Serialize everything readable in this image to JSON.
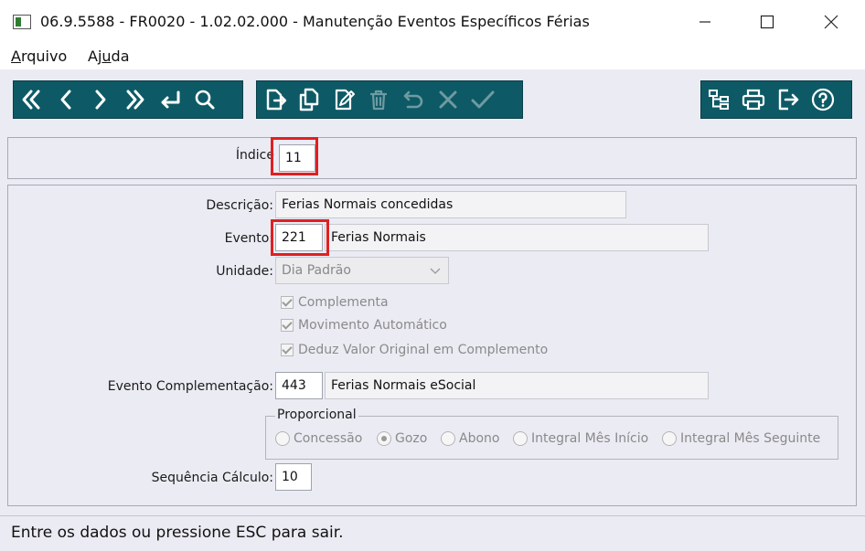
{
  "window": {
    "title": "06.9.5588 - FR0020 - 1.02.02.000 - Manutenção Eventos Específicos Férias"
  },
  "menu": {
    "arquivo": {
      "accel": "A",
      "rest": "rquivo"
    },
    "ajuda": {
      "pre": "Aj",
      "accel": "u",
      "rest": "da"
    }
  },
  "toolbar": {
    "nav": [
      "first-icon",
      "previous-icon",
      "next-icon",
      "last-icon",
      "goto-icon",
      "search-icon"
    ],
    "edit": [
      "new-icon",
      "copy-icon",
      "edit-icon",
      "delete-icon",
      "undo-icon",
      "cancel-icon",
      "confirm-icon"
    ],
    "tools": [
      "tree-icon",
      "print-icon",
      "exit-icon",
      "help-icon"
    ],
    "icon_color": "#ffffff",
    "disabled_icon_color": "#6f9aa1"
  },
  "form": {
    "indice_label": "Índice",
    "indice_value": "11",
    "descricao_label": "Descrição:",
    "descricao_value": "Ferias Normais concedidas",
    "evento_label": "Evento:",
    "evento_code": "221",
    "evento_desc": "Ferias Normais",
    "unidade_label": "Unidade:",
    "unidade_value": "Dia Padrão",
    "checkboxes": [
      {
        "label": "Complementa",
        "checked": true
      },
      {
        "label": "Movimento Automático",
        "checked": true
      },
      {
        "label": "Deduz Valor Original em Complemento",
        "checked": true
      }
    ],
    "evento_compl_label": "Evento Complementação:",
    "evento_compl_code": "443",
    "evento_compl_desc": "Ferias Normais eSocial",
    "proporcional_label": "Proporcional",
    "radios": [
      {
        "label": "Concessão",
        "selected": false
      },
      {
        "label": "Gozo",
        "selected": true
      },
      {
        "label": "Abono",
        "selected": false
      },
      {
        "label": "Integral Mês Início",
        "selected": false
      },
      {
        "label": "Integral Mês Seguinte",
        "selected": false
      }
    ],
    "sequencia_label": "Sequência Cálculo:",
    "sequencia_value": "10"
  },
  "status": {
    "text": "Entre os dados ou pressione ESC para sair."
  },
  "colors": {
    "toolbar_bg": "#0d5a66",
    "workspace_bg": "#ebebf4",
    "highlight": "#e02020"
  }
}
